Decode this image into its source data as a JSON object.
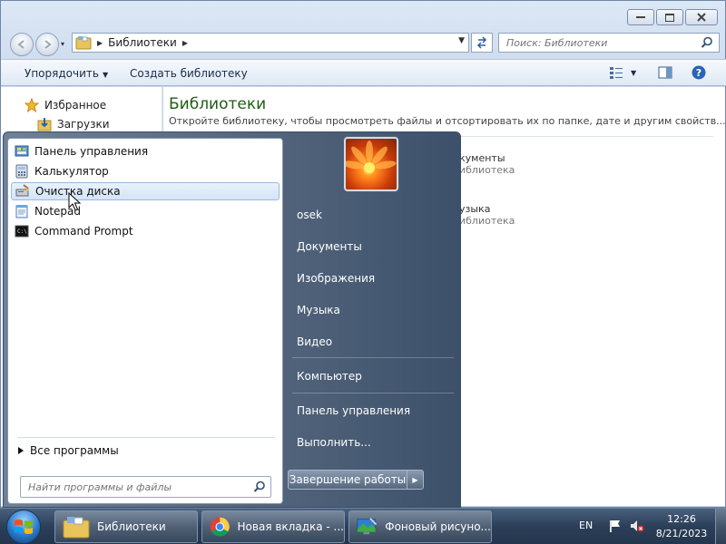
{
  "window": {
    "address_segment": "Библиотеки",
    "search_placeholder": "Поиск: Библиотеки",
    "toolbar": {
      "organize_label": "Упорядочить",
      "create_library_label": "Создать библиотеку"
    },
    "nav": {
      "favorites_label": "Избранное",
      "downloads_label": "Загрузки"
    },
    "content": {
      "title": "Библиотеки",
      "subtitle": "Откройте библиотеку, чтобы просмотреть файлы и отсортировать их по папке, дате и другим свойств...",
      "libraries": [
        {
          "name_visible": "кументы",
          "type_visible": "иблиотека"
        },
        {
          "name_visible": "узыка",
          "type_visible": "иблиотека"
        }
      ]
    }
  },
  "start_menu": {
    "recent_programs": [
      {
        "label": "Панель управления",
        "icon": "control-panel-icon",
        "highlighted": false
      },
      {
        "label": "Калькулятор",
        "icon": "calculator-icon",
        "highlighted": false
      },
      {
        "label": "Очистка диска",
        "icon": "disk-cleanup-icon",
        "highlighted": true
      },
      {
        "label": "Notepad",
        "icon": "notepad-icon",
        "highlighted": false
      },
      {
        "label": "Command Prompt",
        "icon": "command-prompt-icon",
        "highlighted": false
      }
    ],
    "all_programs_label": "Все программы",
    "search_placeholder": "Найти программы и файлы",
    "right_items": {
      "user": "osek",
      "documents": "Документы",
      "pictures": "Изображения",
      "music": "Музыка",
      "videos": "Видео",
      "computer": "Компьютер",
      "control_panel": "Панель управления",
      "run": "Выполнить..."
    },
    "shutdown_label": "Завершение работы"
  },
  "taskbar": {
    "tasks": [
      {
        "label": "Библиотеки",
        "icon": "libraries-folder-icon"
      },
      {
        "label": "Новая вкладка - ...",
        "icon": "chrome-icon"
      },
      {
        "label": "Фоновый рисуно...",
        "icon": "desktop-background-icon"
      }
    ],
    "language": "EN",
    "time": "12:26",
    "date": "8/21/2023"
  },
  "colors": {
    "accent_title": "#1e5d14",
    "taskbar": "#2c3f58",
    "start_menu_right": "#4c5f77",
    "highlight": "#d4e4f7"
  }
}
